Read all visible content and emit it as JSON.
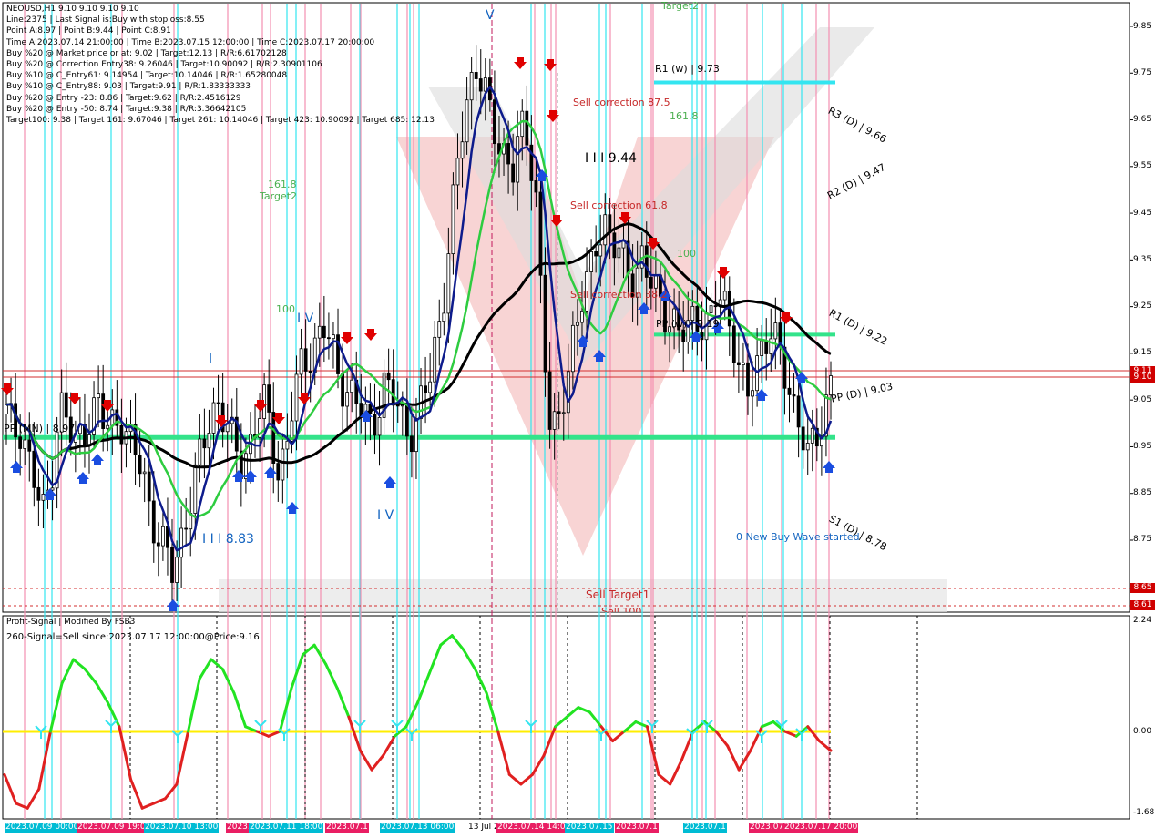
{
  "header": {
    "symbol_line": "NEOUSD,H1  9.10 9.10 9.10 9.10",
    "info_lines": [
      "Line:2375  |  Last Signal is:Buy with stoploss:8.55",
      "Point A:8.97  |  Point B:9.44  |  Point C:8.91",
      "Time A:2023.07.14 21:00:00  |  Time B:2023.07.15 12:00:00  |  Time C:2023.07.17 20:00:00",
      "Buy %20 @ Market price or at: 9.02  |  Target:12.13  |  R/R:6.61702128",
      "Buy %20 @ Correction Entry38: 9.26046  |  Target:10.90092  |  R/R:2.30901106",
      "Buy %10 @ C_Entry61: 9.14954  |  Target:10.14046  |  R/R:1.65280048",
      "Buy %10 @ C_Entry88: 9.03  |  Target:9.91  |  R/R:1.83333333",
      "Buy %20 @ Entry -23: 8.86  |  Target:9.62  |  R/R:2.4516129",
      "Buy %20 @ Entry -50: 8.74  |  Target:9.38  |  R/R:3.36642105",
      "Target100: 9.38  |  Target 161: 9.67046  |  Target 261: 10.14046  |  Target 423: 10.90092  |  Target 685: 12.13"
    ]
  },
  "price_axis": {
    "ticks": [
      "9.85",
      "9.75",
      "9.65",
      "9.55",
      "9.45",
      "9.35",
      "9.25",
      "9.15",
      "9.05",
      "8.95",
      "8.85",
      "8.75"
    ],
    "tags": [
      {
        "label": "9.11",
        "color": "#d00000"
      },
      {
        "label": "9.10",
        "color": "#d00000"
      },
      {
        "label": "8.65",
        "color": "#d00000"
      },
      {
        "label": "8.61",
        "color": "#d00000"
      }
    ]
  },
  "oscillator": {
    "title": "Profit-Signal | Modified By FSB3",
    "signal_text": "260-Signal=Sell since:2023.07.17 12:00:00@Price:9.16",
    "ticks": [
      "2.24",
      "0.00",
      "-1.68"
    ]
  },
  "annotations": {
    "r1_weekly": "R1 (w) | 9.73",
    "r3_daily": "R3 (D) | 9.66",
    "r2_daily": "R2 (D) | 9.47",
    "r1_daily": "R1 (D) | 9.22",
    "pp_daily": "PP (D) | 9.03",
    "s1_daily": "S1 (D) | 8.78",
    "pp_weekly": "PP (w) | 9.19",
    "pp_monthly": "PP (MN) | 8.97",
    "target2_top": "Target2",
    "target2_left": "Target2",
    "fib161_left": "161.8",
    "fib161_right": "161.8",
    "fib100_left": "100",
    "fib100_right": "100",
    "sell_corr_875": "Sell correction 87.5",
    "sell_corr_618": "Sell correction 61.8",
    "sell_corr_382": "Sell correction 38.2",
    "wave_b": "I I I 9.44",
    "wave_c": "I I I 8.83",
    "wave_iv_top": "I V",
    "wave_iv_bottom": "I V",
    "wave_i": "I",
    "wave_v": "V",
    "new_buy": "0 New Buy Wave started",
    "sell_target1": "Sell Target1",
    "sell_100": "Sell 100"
  },
  "time_axis": {
    "labels": [
      {
        "text": "2023.07.09 00:00",
        "color": "#00bcd4"
      },
      {
        "text": "2023.07.09 19:00",
        "color": "#e91e63"
      },
      {
        "text": "2023.07.10 13:00",
        "color": "#00bcd4"
      },
      {
        "text": "2023.07.11",
        "color": "#e91e63"
      },
      {
        "text": "2023.07.11 18:00",
        "color": "#00bcd4"
      },
      {
        "text": "2023.07.1",
        "color": "#e91e63"
      },
      {
        "text": "2023.07.13 06:00",
        "color": "#00bcd4"
      },
      {
        "text": "13 Jul 2",
        "color": "none"
      },
      {
        "text": "2023.07.14 14:00",
        "color": "#e91e63"
      },
      {
        "text": "2023.07.15",
        "color": "#00bcd4"
      },
      {
        "text": "2023.07.1",
        "color": "#e91e63"
      },
      {
        "text": "2023.07.1",
        "color": "#00bcd4"
      },
      {
        "text": "2023.07",
        "color": "#e91e63"
      },
      {
        "text": "2023.07.17 20:00",
        "color": "#e91e63"
      }
    ]
  },
  "chart_data": {
    "type": "candlestick",
    "symbol": "NEOUSD",
    "timeframe": "H1",
    "ylim": [
      8.6,
      9.92
    ],
    "osc_ylim": [
      -1.68,
      2.24
    ],
    "current_price": 9.1,
    "levels": {
      "R1_w": 9.73,
      "R3_D": 9.66,
      "R2_D": 9.47,
      "R1_D": 9.22,
      "PP_D": 9.03,
      "S1_D": 8.78,
      "PP_w": 9.19,
      "PP_MN": 8.97,
      "sell_target1": 8.65,
      "sell_100": 8.61
    },
    "close_path": [
      9.02,
      8.98,
      9.0,
      8.92,
      8.85,
      8.8,
      8.9,
      9.05,
      9.0,
      8.95,
      8.98,
      9.02,
      9.04,
      8.99,
      9.0,
      9.02,
      8.97,
      8.93,
      8.9,
      8.82,
      8.76,
      8.72,
      8.68,
      8.75,
      8.82,
      8.88,
      8.95,
      9.02,
      9.05,
      9.0,
      8.95,
      8.92,
      8.95,
      9.0,
      9.04,
      8.98,
      8.9,
      8.95,
      9.05,
      9.12,
      9.15,
      9.18,
      9.2,
      9.16,
      9.1,
      9.08,
      9.05,
      9.02,
      9.0,
      9.03,
      9.08,
      9.06,
      9.02,
      9.0,
      8.98,
      9.05,
      9.1,
      9.2,
      9.3,
      9.45,
      9.6,
      9.7,
      9.78,
      9.72,
      9.65,
      9.6,
      9.58,
      9.55,
      9.62,
      9.6,
      9.5,
      9.2,
      8.95,
      9.0,
      9.1,
      9.2,
      9.25,
      9.3,
      9.4,
      9.44,
      9.38,
      9.36,
      9.34,
      9.32,
      9.35,
      9.3,
      9.28,
      9.25,
      9.22,
      9.18,
      9.2,
      9.24,
      9.22,
      9.2,
      9.28,
      9.26,
      9.2,
      9.1,
      9.05,
      9.12,
      9.18,
      9.2,
      9.15,
      9.1,
      9.05,
      9.0,
      8.92,
      8.96,
      9.02,
      9.1
    ],
    "wave_points": {
      "A": 8.97,
      "B": 9.44,
      "C": 8.91
    },
    "osc_series": [
      -0.9,
      -1.5,
      -1.6,
      -1.2,
      0.0,
      1.0,
      1.5,
      1.3,
      1.0,
      0.6,
      0.1,
      -1.0,
      -1.6,
      -1.5,
      -1.4,
      -1.1,
      0.0,
      1.1,
      1.5,
      1.3,
      0.8,
      0.1,
      0.0,
      -0.1,
      0.0,
      0.9,
      1.6,
      1.8,
      1.4,
      0.9,
      0.3,
      -0.4,
      -0.8,
      -0.5,
      -0.1,
      0.1,
      0.6,
      1.2,
      1.8,
      2.0,
      1.7,
      1.3,
      0.8,
      0.0,
      -0.9,
      -1.1,
      -0.9,
      -0.5,
      0.1,
      0.3,
      0.5,
      0.4,
      0.1,
      -0.2,
      0.0,
      0.2,
      0.1,
      -0.9,
      -1.1,
      -0.6,
      0.0,
      0.2,
      0.0,
      -0.3,
      -0.8,
      -0.4,
      0.1,
      0.2,
      0.0,
      -0.1,
      0.1,
      -0.2,
      -0.4
    ]
  }
}
